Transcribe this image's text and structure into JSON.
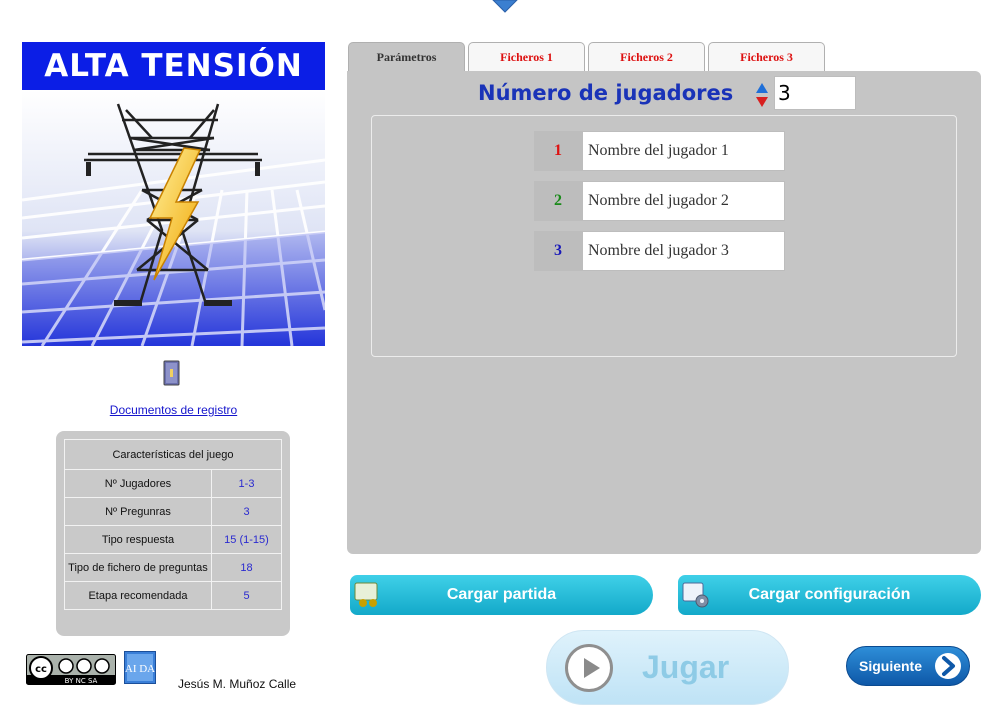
{
  "app": {
    "title": "ALTA TENSIÓN"
  },
  "sidebar": {
    "registry_link": "Documentos de registro",
    "features": {
      "header": "Características del juego",
      "rows": [
        {
          "label": "Nº Jugadores",
          "value": "1-3"
        },
        {
          "label": "Nº Pregunras",
          "value": "3"
        },
        {
          "label": "Tipo respuesta",
          "value": "15 (1-15)"
        },
        {
          "label": "Tipo de fichero de preguntas",
          "value": "18"
        },
        {
          "label": "Etapa recomendada",
          "value": "5"
        }
      ]
    },
    "license_badge": "BY NC SA",
    "aida_logo": "AI DA",
    "author": "Jesús M. Muñoz Calle"
  },
  "tabs": [
    {
      "label": "Parámetros",
      "active": true
    },
    {
      "label": "Ficheros 1",
      "active": false
    },
    {
      "label": "Ficheros 2",
      "active": false
    },
    {
      "label": "Ficheros 3",
      "active": false
    }
  ],
  "params": {
    "num_players_label": "Número de jugadores",
    "num_players_value": "3",
    "players": [
      {
        "num": "1",
        "name": "Nombre del jugador 1",
        "color": "#dd1111"
      },
      {
        "num": "2",
        "name": "Nombre del jugador 2",
        "color": "#1a8a1a"
      },
      {
        "num": "3",
        "name": "Nombre del jugador 3",
        "color": "#1a1ab8"
      }
    ]
  },
  "buttons": {
    "load_game": "Cargar partida",
    "load_config": "Cargar configuración",
    "play": "Jugar",
    "next": "Siguiente"
  },
  "colors": {
    "title_bg": "#0b1ee6",
    "panel_bg": "#c5c5c5",
    "button_teal": "#13a9c9",
    "next_blue": "#0e58a8"
  }
}
